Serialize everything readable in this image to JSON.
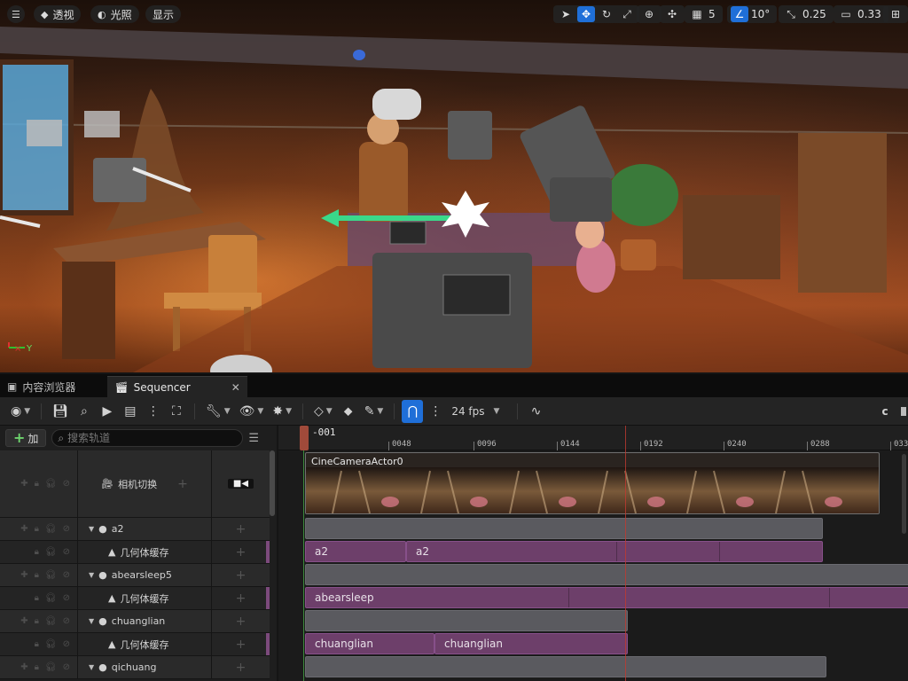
{
  "viewport": {
    "buttons": {
      "perspective": "透视",
      "lighting": "光照",
      "show": "显示"
    },
    "right_tools": {
      "grid_value": "5",
      "angle_value": "10°",
      "scale_value": "0.25",
      "camera_speed": "0.33"
    }
  },
  "tabs": [
    {
      "label": "内容浏览器"
    },
    {
      "label": "Sequencer"
    }
  ],
  "toolbar": {
    "fps": "24 fps",
    "right_letter": "c"
  },
  "outliner": {
    "add_label": "加",
    "search_placeholder": "搜索轨道",
    "camera_cut": "相机切换",
    "tracks": [
      {
        "name": "a2",
        "child": "几何体缓存"
      },
      {
        "name": "abearsleep5",
        "child": "几何体缓存"
      },
      {
        "name": "chuanglian",
        "child": "几何体缓存"
      },
      {
        "name": "qichuang"
      }
    ]
  },
  "timeline": {
    "current_frame": "-001",
    "ticks": [
      "0048",
      "0096",
      "0144",
      "0192",
      "0240",
      "0288",
      "033"
    ],
    "camera_clip": "CineCameraActor0",
    "clips": {
      "a2_1": "a2",
      "a2_2": "a2",
      "abearsleep": "abearsleep",
      "chuanglian_1": "chuanglian",
      "chuanglian_2": "chuanglian"
    }
  },
  "colors": {
    "accent_blue": "#1f6fd8",
    "clip_purple": "#6d3f6a",
    "clip_grey": "#5a5a5f",
    "playhead": "#c03a30"
  }
}
